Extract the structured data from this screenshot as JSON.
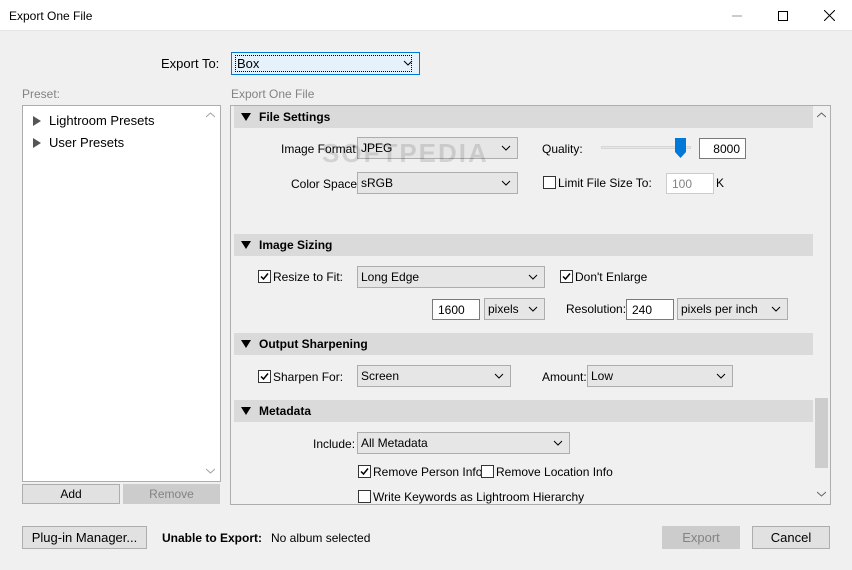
{
  "window": {
    "title": "Export One File"
  },
  "export_to": {
    "label": "Export To:",
    "value": "Box"
  },
  "preset": {
    "label": "Preset:",
    "items": [
      "Lightroom Presets",
      "User Presets"
    ],
    "add_label": "Add",
    "remove_label": "Remove"
  },
  "panel_title": "Export One File",
  "file_settings": {
    "header": "File Settings",
    "image_format_label": "Image Format:",
    "image_format_value": "JPEG",
    "quality_label": "Quality:",
    "quality_value": "8000",
    "color_space_label": "Color Space:",
    "color_space_value": "sRGB",
    "limit_label": "Limit File Size To:",
    "limit_value": "100",
    "limit_unit": "K",
    "watermark": "SOFTPEDIA"
  },
  "image_sizing": {
    "header": "Image Sizing",
    "resize_label": "Resize to Fit:",
    "resize_value": "Long Edge",
    "dont_enlarge_label": "Don't Enlarge",
    "size_value": "1600",
    "size_unit": "pixels",
    "resolution_label": "Resolution:",
    "resolution_value": "240",
    "resolution_unit": "pixels per inch"
  },
  "output_sharpening": {
    "header": "Output Sharpening",
    "sharpen_label": "Sharpen For:",
    "sharpen_value": "Screen",
    "amount_label": "Amount:",
    "amount_value": "Low"
  },
  "metadata": {
    "header": "Metadata",
    "include_label": "Include:",
    "include_value": "All Metadata",
    "remove_person_label": "Remove Person Info",
    "remove_location_label": "Remove Location Info",
    "write_keywords_label": "Write Keywords as Lightroom Hierarchy"
  },
  "footer": {
    "plugin_manager": "Plug-in Manager...",
    "unable_label": "Unable to Export:",
    "unable_value": "No album selected",
    "export_label": "Export",
    "cancel_label": "Cancel"
  }
}
